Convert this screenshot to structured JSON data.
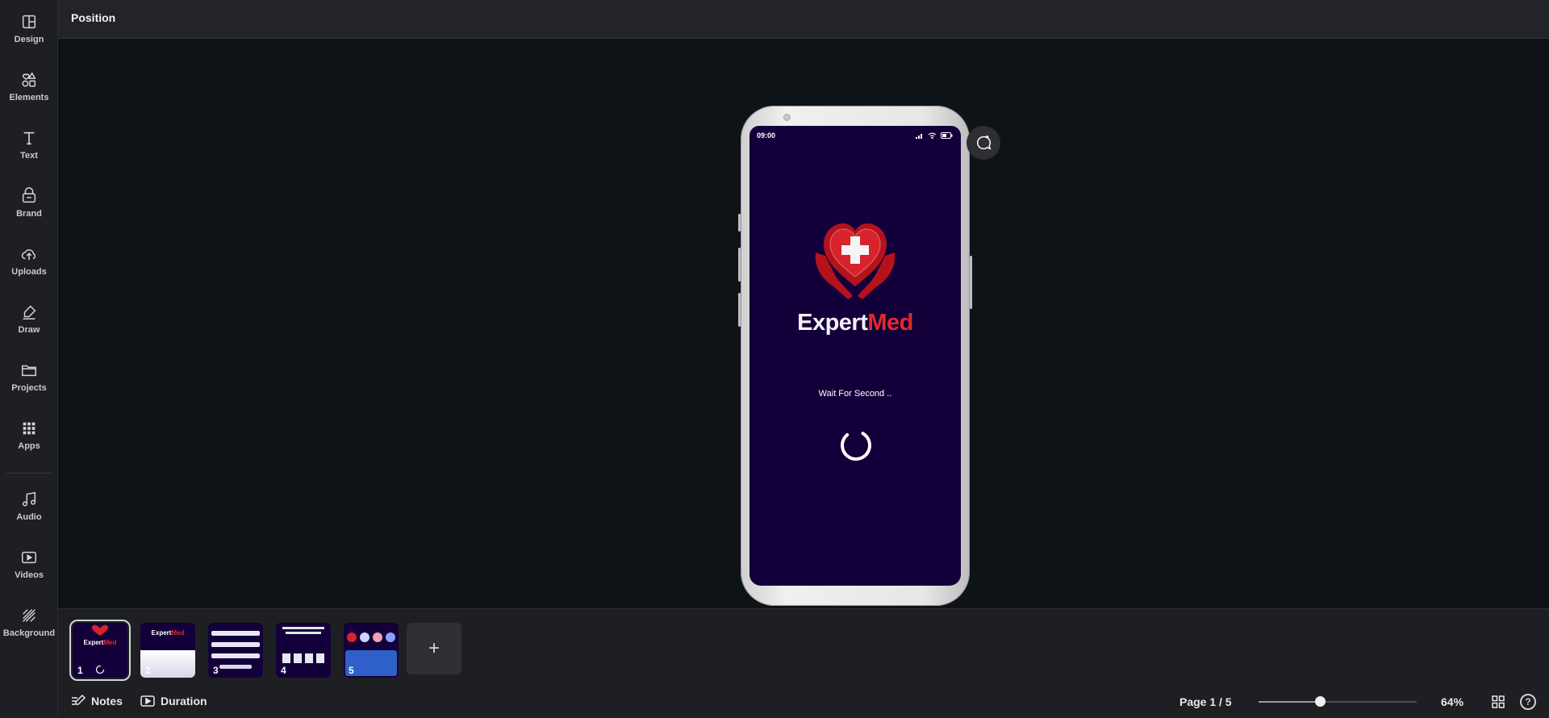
{
  "topbar": {
    "title": "Position"
  },
  "sidebar": {
    "items": [
      {
        "label": "Design",
        "icon": "layout-icon"
      },
      {
        "label": "Elements",
        "icon": "shapes-icon"
      },
      {
        "label": "Text",
        "icon": "text-icon"
      },
      {
        "label": "Brand",
        "icon": "brand-icon"
      },
      {
        "label": "Uploads",
        "icon": "upload-cloud-icon"
      },
      {
        "label": "Draw",
        "icon": "pen-icon"
      },
      {
        "label": "Projects",
        "icon": "folder-icon"
      },
      {
        "label": "Apps",
        "icon": "apps-grid-icon"
      },
      {
        "label": "Audio",
        "icon": "music-note-icon"
      },
      {
        "label": "Videos",
        "icon": "video-icon"
      },
      {
        "label": "Background",
        "icon": "background-icon"
      }
    ]
  },
  "design": {
    "status_time": "09:00",
    "brand_white": "Expert",
    "brand_red": "Med",
    "wait_text": "Wait For Second ..",
    "colors": {
      "screen_bg": "#13003a",
      "brand_red": "#e02a2a"
    }
  },
  "pages": {
    "thumbnails": [
      {
        "num": "1",
        "active": true
      },
      {
        "num": "2",
        "active": false
      },
      {
        "num": "3",
        "active": false
      },
      {
        "num": "4",
        "active": false
      },
      {
        "num": "5",
        "active": false
      }
    ],
    "add_label": "+"
  },
  "footer": {
    "notes_label": "Notes",
    "duration_label": "Duration",
    "page_indicator": "Page 1 / 5",
    "zoom_label": "64%",
    "zoom_slider_fraction": 0.39,
    "help_label": "?"
  }
}
